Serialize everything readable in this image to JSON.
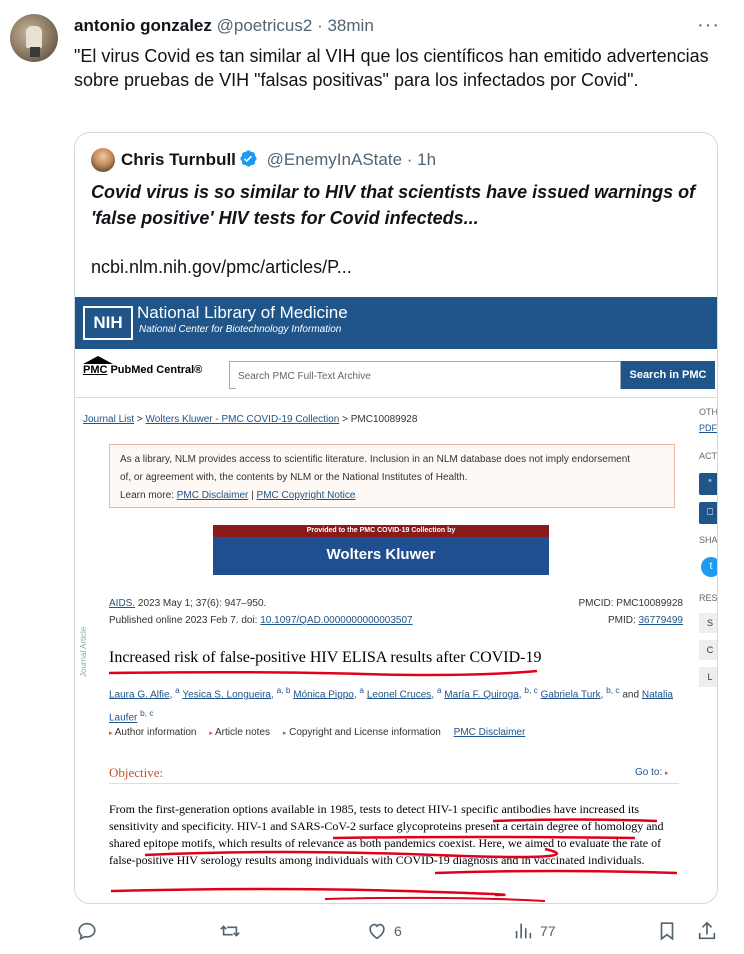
{
  "tweet": {
    "author_name": "antonio gonzalez",
    "author_handle": "@poetricus2",
    "separator": "·",
    "time": "38min",
    "more": "···",
    "text": "\"El virus Covid es tan similar al VIH que los científicos han emitido advertencias sobre pruebas de VIH \"falsas positivas\" para los infectados por Covid\"."
  },
  "quote": {
    "author_name": "Chris Turnbull",
    "author_handle": "@EnemyInAState",
    "separator": "·",
    "time": "1h",
    "text": "Covid virus is so similar to HIV that scientists have issued warnings of 'false positive' HIV tests for Covid infecteds...",
    "link": "ncbi.nlm.nih.gov/pmc/articles/P..."
  },
  "screenshot": {
    "nih_logo": "NIH",
    "nlm_title": "National Library of Medicine",
    "nlm_subtitle": "National Center for Biotechnology Information",
    "pmc_logo": "PMC",
    "pmc_name": "PubMed Central®",
    "search_placeholder": "Search PMC Full-Text Archive",
    "search_button": "Search in PMC",
    "breadcrumb": {
      "item1": "Journal List",
      "sep": ">",
      "item2": "Wolters Kluwer - PMC COVID-19 Collection",
      "item3": "PMC10089928"
    },
    "right_col": {
      "oth": "OTH",
      "pdf": "PDF",
      "act": "ACT",
      "quote_icon": "“",
      "bookmark_icon": "⎕",
      "sha": "SHA",
      "twitter_icon": "t",
      "res": "RES",
      "r1": "S",
      "r2": "C",
      "r3": "L"
    },
    "notice": {
      "line1": "As a library, NLM provides access to scientific literature. Inclusion in an NLM database does not imply endorsement",
      "line2": "of, or agreement with, the contents by NLM or the National Institutes of Health.",
      "learn_more": "Learn more:",
      "link1": "PMC Disclaimer",
      "pipe": "|",
      "link2": "PMC Copyright Notice"
    },
    "wk_banner_top": "Provided to the PMC COVID-19 Collection by",
    "wk_banner_main": "Wolters Kluwer",
    "journal": "AIDS.",
    "citation": "2023 May 1; 37(6): 947–950.",
    "published": "Published online 2023 Feb 7. doi:",
    "doi": "10.1097/QAD.0000000000003507",
    "pmcid": "PMCID: PMC10089928",
    "pmid_label": "PMID:",
    "pmid": "36779499",
    "journal_article_label": "Journal Article",
    "article_title": "Increased risk of false-positive HIV ELISA results after COVID-19",
    "authors": [
      {
        "name": "Laura G. Alfie",
        "sup": "a"
      },
      {
        "name": "Yesica S. Longueira",
        "sup": "a, b"
      },
      {
        "name": "Mónica Pippo",
        "sup": "a"
      },
      {
        "name": "Leonel Cruces",
        "sup": "a"
      },
      {
        "name": "María F. Quiroga",
        "sup": "b, c"
      },
      {
        "name": "Gabriela Turk",
        "sup": "b, c"
      },
      {
        "name": "Natalia Laufer",
        "sup": "b, c"
      }
    ],
    "authors_and": "and",
    "tabs": [
      "Author information",
      "Article notes",
      "Copyright and License information"
    ],
    "tab_disclaimer": "PMC Disclaimer",
    "objective": "Objective:",
    "goto": "Go to:",
    "abstract": "From the first-generation options available in 1985, tests to detect HIV-1 specific antibodies have increased its sensitivity and specificity. HIV-1 and SARS-CoV-2 surface glycoproteins present a certain degree of homology and shared epitope motifs, which results of relevance as both pandemics coexist. Here, we aimed to evaluate the rate of false-positive HIV serology results among individuals with COVID-19 diagnosis and in vaccinated individuals."
  },
  "actions": {
    "reply_count": "",
    "retweet_count": "",
    "like_count": "6",
    "views_count": "77"
  },
  "colors": {
    "nlm_blue": "#20558a",
    "annotation_red": "#e0001a",
    "muted": "#536471"
  }
}
